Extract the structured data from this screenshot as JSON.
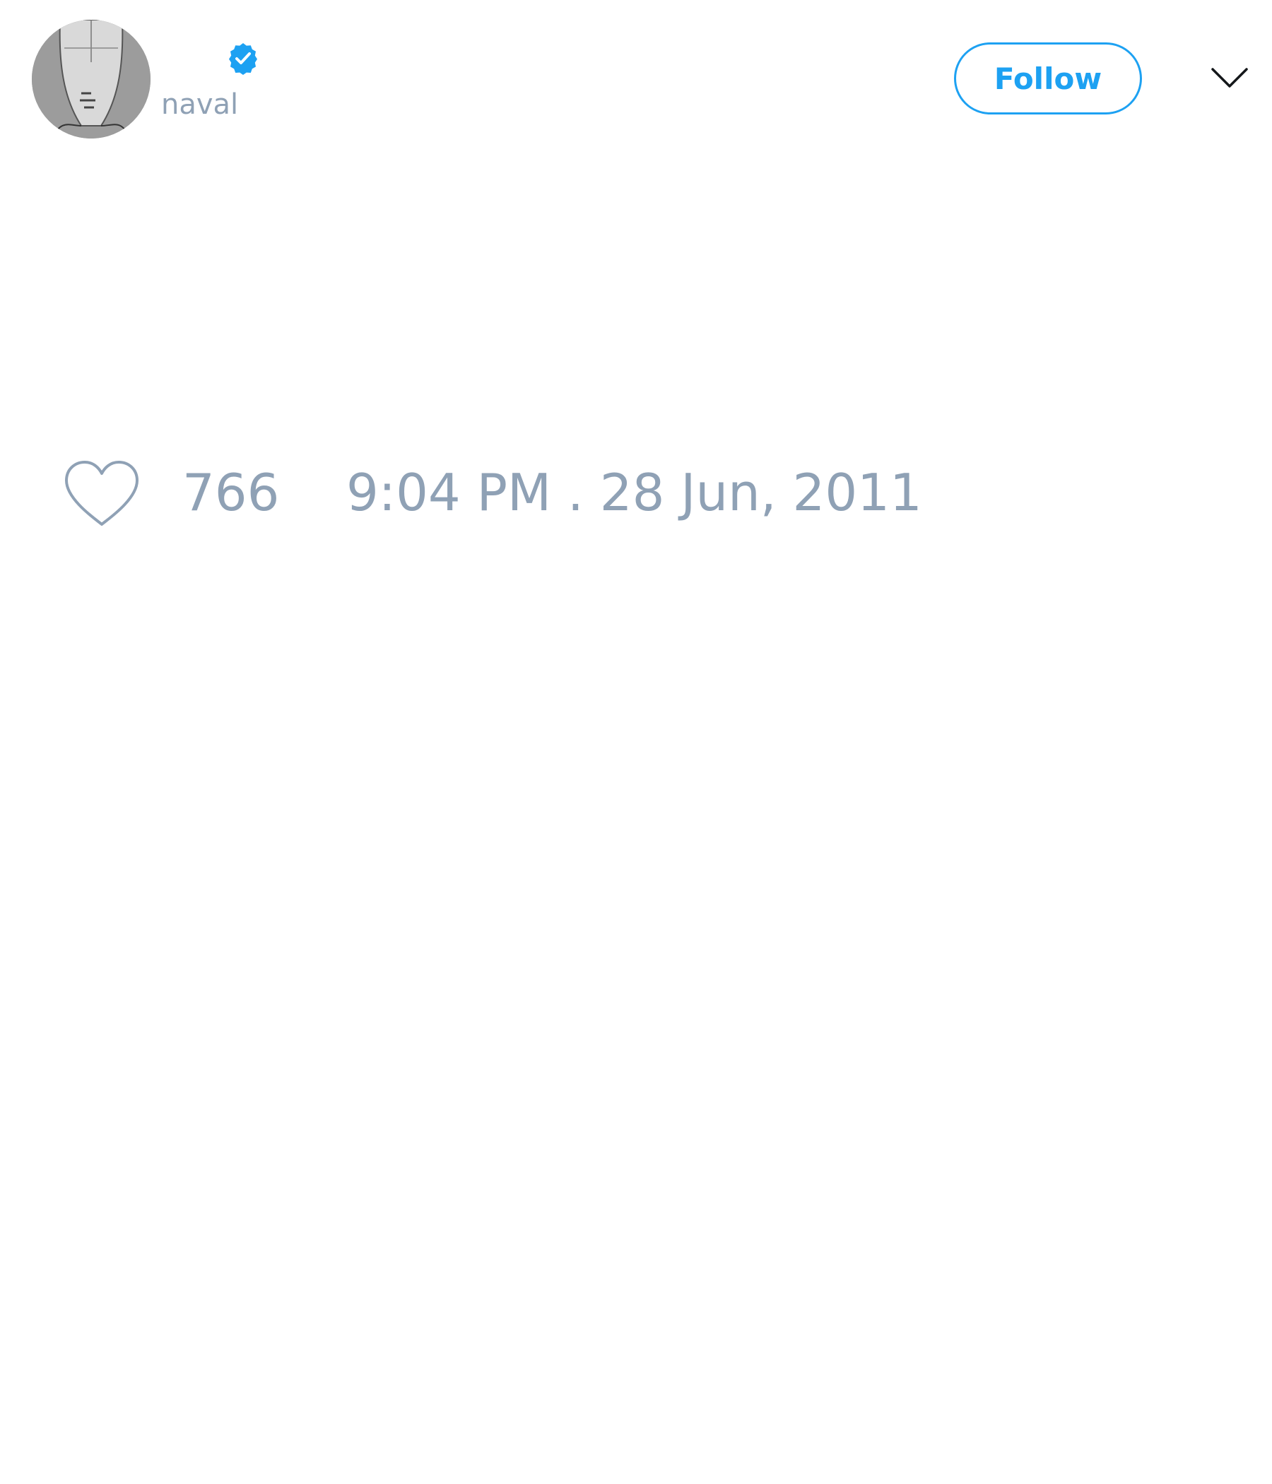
{
  "tweet": {
    "author": {
      "display_name": "",
      "handle": "naval",
      "verified": true,
      "avatar_icon": "avatar-sketch-face"
    },
    "follow_label": "Follow",
    "menu_icon": "chevron-down-icon",
    "likes": "766",
    "timestamp": "9:04 PM . 28 Jun, 2011"
  },
  "colors": {
    "accent": "#1da1f2",
    "muted_text": "#8fa1b5",
    "icon_gray": "#8fa1b5",
    "caret": "#14171a"
  }
}
